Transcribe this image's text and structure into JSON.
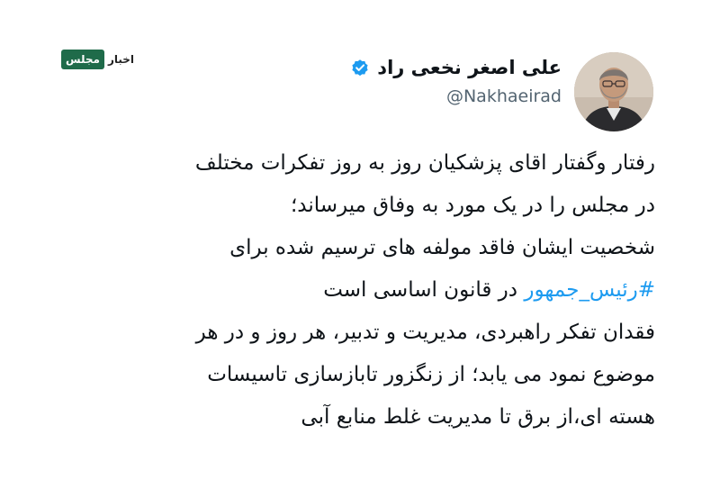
{
  "watermark": {
    "logo_box_text": "مجلس",
    "logo_word_text": "اخبار"
  },
  "author": {
    "display_name": "علی اصغر نخعی راد",
    "handle": "@Nakhaeirad",
    "verified": true,
    "verified_icon": "verified-badge-icon",
    "accent_color": "#1d9bf0"
  },
  "tweet": {
    "line1": "رفتار وگفتار اقای پزشکیان روز به روز تفکرات مختلف",
    "line2": "در مجلس را در یک مورد به وفاق میرساند؛",
    "line3": "شخصیت ایشان فاقد مولفه های ترسیم شده برای",
    "line4_hashtag": "#رئیس_جمهور",
    "line4_rest": " در قانون اساسی است",
    "line5": "فقدان تفکر راهبردی، مدیریت و تدبیر، هر روز و در هر",
    "line6": "موضوع نمود می یابد؛ از زنگزور تابازسازی تاسیسات",
    "line7": "هسته ای،از برق تا مدیریت غلط منابع آبی"
  }
}
